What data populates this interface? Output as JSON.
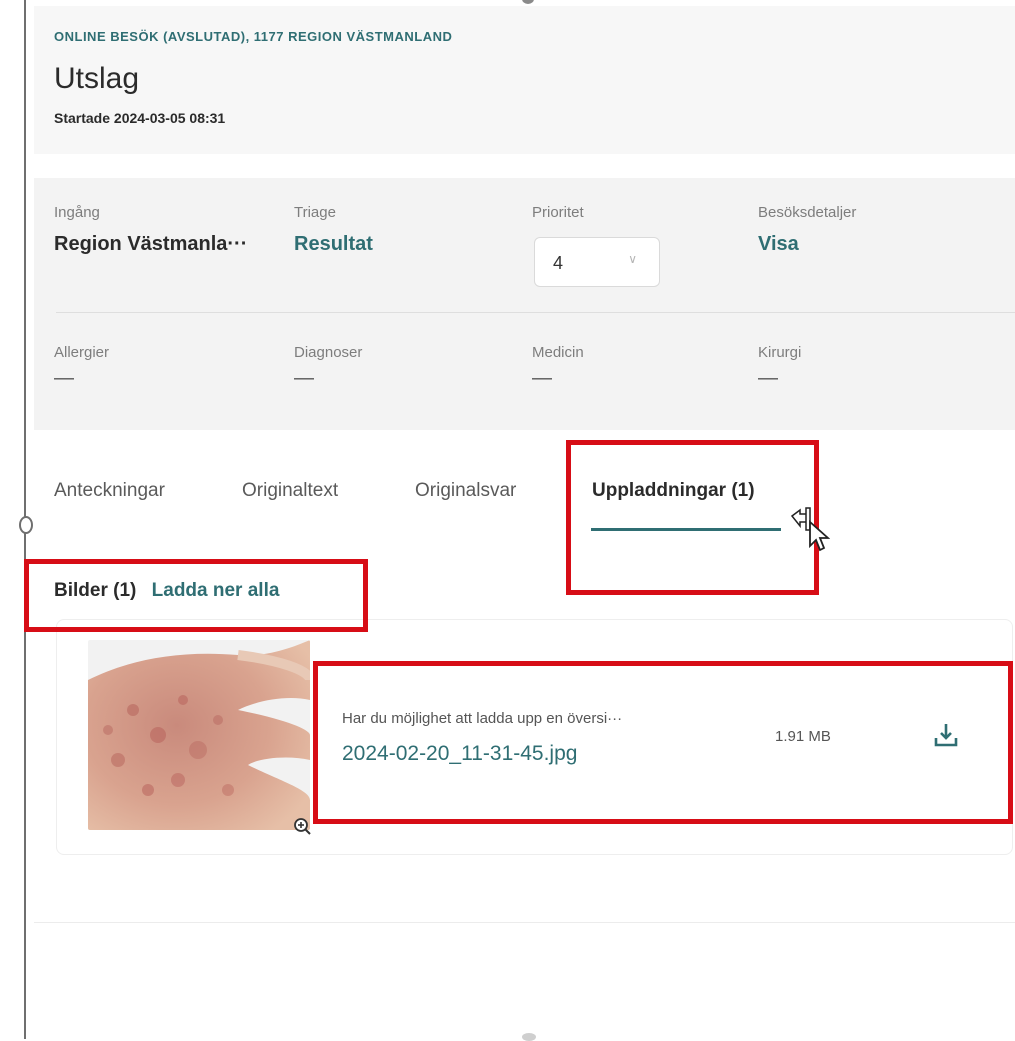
{
  "header": {
    "kicker": "ONLINE BESÖK (AVSLUTAD), 1177 REGION VÄSTMANLAND",
    "title": "Utslag",
    "started": "Startade 2024-03-05 08:31"
  },
  "info": {
    "row1": [
      {
        "label": "Ingång",
        "value": "Region Västmanla···",
        "style": "text"
      },
      {
        "label": "Triage",
        "value": "Resultat",
        "style": "link"
      },
      {
        "label": "Prioritet",
        "value": "4",
        "style": "select"
      },
      {
        "label": "Besöksdetaljer",
        "value": "Visa",
        "style": "link"
      }
    ],
    "row2": [
      {
        "label": "Allergier",
        "value": "—"
      },
      {
        "label": "Diagnoser",
        "value": "—"
      },
      {
        "label": "Medicin",
        "value": "—"
      },
      {
        "label": "Kirurgi",
        "value": "—"
      }
    ]
  },
  "tabs": [
    {
      "label": "Anteckningar",
      "active": false
    },
    {
      "label": "Originaltext",
      "active": false
    },
    {
      "label": "Originalsvar",
      "active": false
    },
    {
      "label": "Uppladdningar (1)",
      "active": true
    }
  ],
  "images_section": {
    "count_label": "Bilder (1)",
    "download_all": "Ladda ner alla"
  },
  "file": {
    "description": "Har du möjlighet att ladda upp en översi···",
    "filename": "2024-02-20_11-31-45.jpg",
    "size": "1.91 MB",
    "thumbnail_icon": "zoom-in-icon",
    "download_icon": "download-icon"
  },
  "colors": {
    "accent": "#2f6e73",
    "highlight": "#d70d16",
    "panel": "#f3f3f3"
  }
}
